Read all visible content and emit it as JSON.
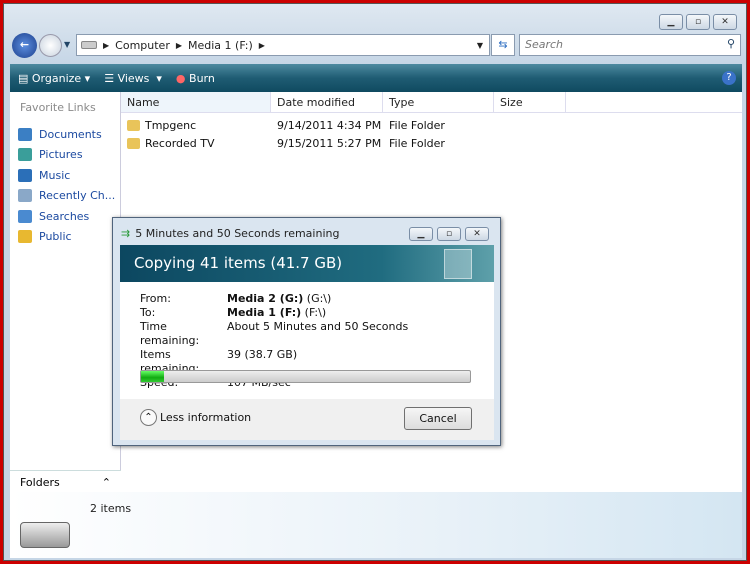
{
  "window": {
    "controls": [
      "minimize",
      "maximize",
      "close"
    ]
  },
  "address": {
    "crumbs": [
      "Computer",
      "Media 1 (F:)"
    ],
    "search_placeholder": "Search"
  },
  "toolbar": {
    "organize": "Organize",
    "views": "Views",
    "burn": "Burn"
  },
  "sidebar": {
    "title": "Favorite Links",
    "items": [
      {
        "label": "Documents",
        "color": "#3b7fc4"
      },
      {
        "label": "Pictures",
        "color": "#3a9e9a"
      },
      {
        "label": "Music",
        "color": "#2b6fb8"
      },
      {
        "label": "Recently Ch...",
        "color": "#8aa8c8"
      },
      {
        "label": "Searches",
        "color": "#4a8ad0"
      },
      {
        "label": "Public",
        "color": "#e8b830"
      }
    ],
    "folders": "Folders"
  },
  "columns": [
    "Name",
    "Date modified",
    "Type",
    "Size"
  ],
  "files": [
    {
      "name": "Tmpgenc",
      "date": "9/14/2011 4:34 PM",
      "type": "File Folder"
    },
    {
      "name": "Recorded TV",
      "date": "9/15/2011 5:27 PM",
      "type": "File Folder"
    }
  ],
  "details": {
    "count": "2 items"
  },
  "dialog": {
    "title": "5 Minutes and 50 Seconds remaining",
    "heading": "Copying 41 items (41.7 GB)",
    "rows": [
      {
        "label": "From:",
        "bold": "Media 2 (G:)",
        "value": " (G:\\)"
      },
      {
        "label": "To:",
        "bold": "Media 1 (F:)",
        "value": " (F:\\)"
      },
      {
        "label": "Time remaining:",
        "bold": "",
        "value": "About 5 Minutes and 50 Seconds"
      },
      {
        "label": "Items remaining:",
        "bold": "",
        "value": "39 (38.7 GB)"
      },
      {
        "label": "Speed:",
        "bold": "",
        "value": "107 MB/sec"
      }
    ],
    "progress_percent": 7,
    "less_info": "Less information",
    "cancel": "Cancel"
  }
}
